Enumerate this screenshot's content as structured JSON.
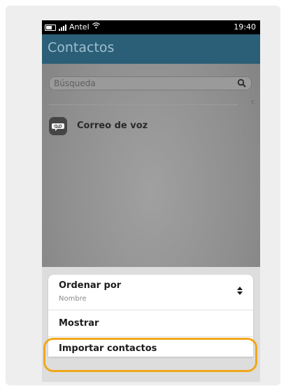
{
  "status_bar": {
    "carrier": "Antel",
    "time": "19:40"
  },
  "header": {
    "title": "Contactos"
  },
  "search": {
    "placeholder": "Búsqueda"
  },
  "contacts": {
    "section_letter": "c",
    "items": [
      {
        "name": "Correo de voz",
        "icon": "voicemail-icon"
      }
    ]
  },
  "menu": {
    "sort": {
      "label": "Ordenar por",
      "value": "Nombre"
    },
    "show": {
      "label": "Mostrar"
    },
    "import": {
      "label": "Importar contactos"
    }
  },
  "colors": {
    "header_bg": "#2b5e77",
    "highlight": "#f0a81c",
    "status_bar_bg": "#000000"
  }
}
